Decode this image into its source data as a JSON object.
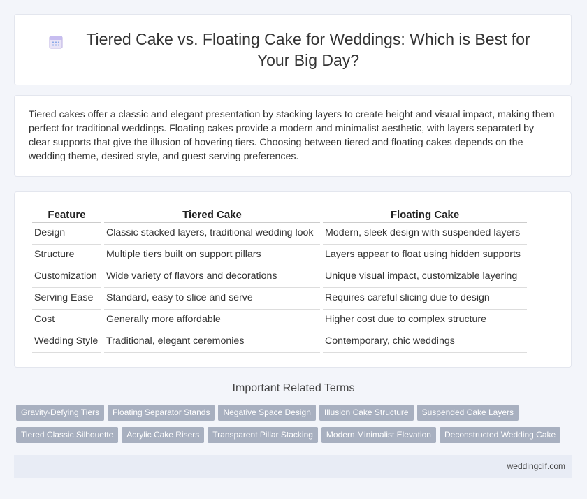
{
  "header": {
    "title": "Tiered Cake vs. Floating Cake for Weddings: Which is Best for Your Big Day?",
    "icon": "calendar-icon"
  },
  "intro": {
    "text": "Tiered cakes offer a classic and elegant presentation by stacking layers to create height and visual impact, making them perfect for traditional weddings. Floating cakes provide a modern and minimalist aesthetic, with layers separated by clear supports that give the illusion of hovering tiers. Choosing between tiered and floating cakes depends on the wedding theme, desired style, and guest serving preferences."
  },
  "table": {
    "headers": [
      "Feature",
      "Tiered Cake",
      "Floating Cake"
    ],
    "rows": [
      [
        "Design",
        "Classic stacked layers, traditional wedding look",
        "Modern, sleek design with suspended layers"
      ],
      [
        "Structure",
        "Multiple tiers built on support pillars",
        "Layers appear to float using hidden supports"
      ],
      [
        "Customization",
        "Wide variety of flavors and decorations",
        "Unique visual impact, customizable layering"
      ],
      [
        "Serving Ease",
        "Standard, easy to slice and serve",
        "Requires careful slicing due to design"
      ],
      [
        "Cost",
        "Generally more affordable",
        "Higher cost due to complex structure"
      ],
      [
        "Wedding Style",
        "Traditional, elegant ceremonies",
        "Contemporary, chic weddings"
      ]
    ]
  },
  "related": {
    "title": "Important Related Terms",
    "tags": [
      "Gravity-Defying Tiers",
      "Floating Separator Stands",
      "Negative Space Design",
      "Illusion Cake Structure",
      "Suspended Cake Layers",
      "Tiered Classic Silhouette",
      "Acrylic Cake Risers",
      "Transparent Pillar Stacking",
      "Modern Minimalist Elevation",
      "Deconstructed Wedding Cake"
    ]
  },
  "footer": {
    "text": "weddingdif.com"
  }
}
